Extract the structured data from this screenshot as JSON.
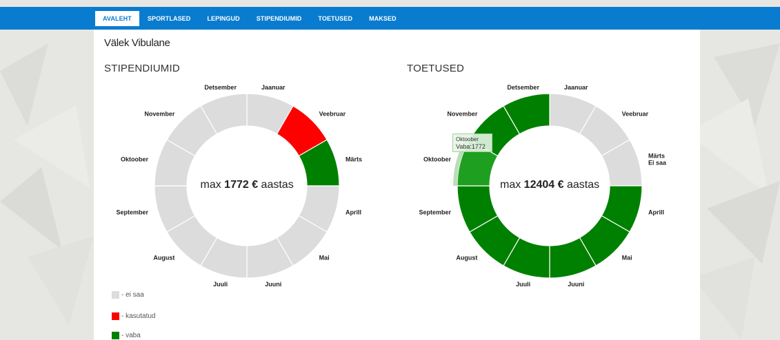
{
  "nav": {
    "items": [
      "AVALEHT",
      "SPORTLASED",
      "LEPINGUD",
      "STIPENDIUMID",
      "TOETUSED",
      "MAKSED"
    ],
    "active_index": 0
  },
  "user": {
    "name": "Välek Vibulane"
  },
  "colors": {
    "navbar": "#0a7ccf",
    "ei_saa": "#dcdcdc",
    "kasutatud": "#ff0000",
    "vaba": "#008000",
    "vaba_highlight": "#1f9f1f"
  },
  "legend": [
    {
      "status": "ei_saa",
      "label": "- ei saa"
    },
    {
      "status": "kasutatud",
      "label": "- kasutatud"
    },
    {
      "status": "vaba",
      "label": "- vaba"
    }
  ],
  "tooltip": {
    "title": "Oktoober",
    "value": "Vaba:1772"
  },
  "chart_data": [
    {
      "type": "pie",
      "title": "STIPENDIUMID",
      "center_prefix": "max ",
      "center_amount": "1772 €",
      "center_suffix": " aastas",
      "categories": [
        "Jaanuar",
        "Veebruar",
        "Märts",
        "Aprill",
        "Mai",
        "Juuni",
        "Juuli",
        "August",
        "September",
        "Oktoober",
        "November",
        "Detsember"
      ],
      "values": [
        1,
        1,
        1,
        1,
        1,
        1,
        1,
        1,
        1,
        1,
        1,
        1
      ],
      "status": [
        "ei_saa",
        "kasutatud",
        "vaba",
        "ei_saa",
        "ei_saa",
        "ei_saa",
        "ei_saa",
        "ei_saa",
        "ei_saa",
        "ei_saa",
        "ei_saa",
        "ei_saa"
      ],
      "labels": [
        "Jaanuar",
        "Veebruar",
        "Märts",
        "Aprill",
        "Mai",
        "Juuni",
        "Juuli",
        "August",
        "September",
        "Oktoober",
        "November",
        "Detsember"
      ]
    },
    {
      "type": "pie",
      "title": "TOETUSED",
      "center_prefix": "max ",
      "center_amount": "12404 €",
      "center_suffix": " aastas",
      "categories": [
        "Jaanuar",
        "Veebruar",
        "Märts",
        "Aprill",
        "Mai",
        "Juuni",
        "Juuli",
        "August",
        "September",
        "Oktoober",
        "November",
        "Detsember"
      ],
      "values": [
        1,
        1,
        1,
        1,
        1,
        1,
        1,
        1,
        1,
        1,
        1,
        1
      ],
      "status": [
        "ei_saa",
        "ei_saa",
        "ei_saa",
        "vaba",
        "vaba",
        "vaba",
        "vaba",
        "vaba",
        "vaba",
        "vaba",
        "vaba",
        "vaba"
      ],
      "labels": [
        "Jaanuar",
        "Veebruar",
        "Märts\nEi saa",
        "Aprill",
        "Mai",
        "Juuni",
        "Juuli",
        "August",
        "September",
        "Oktoober",
        "November",
        "Detsember"
      ],
      "highlighted": "Oktoober"
    }
  ]
}
